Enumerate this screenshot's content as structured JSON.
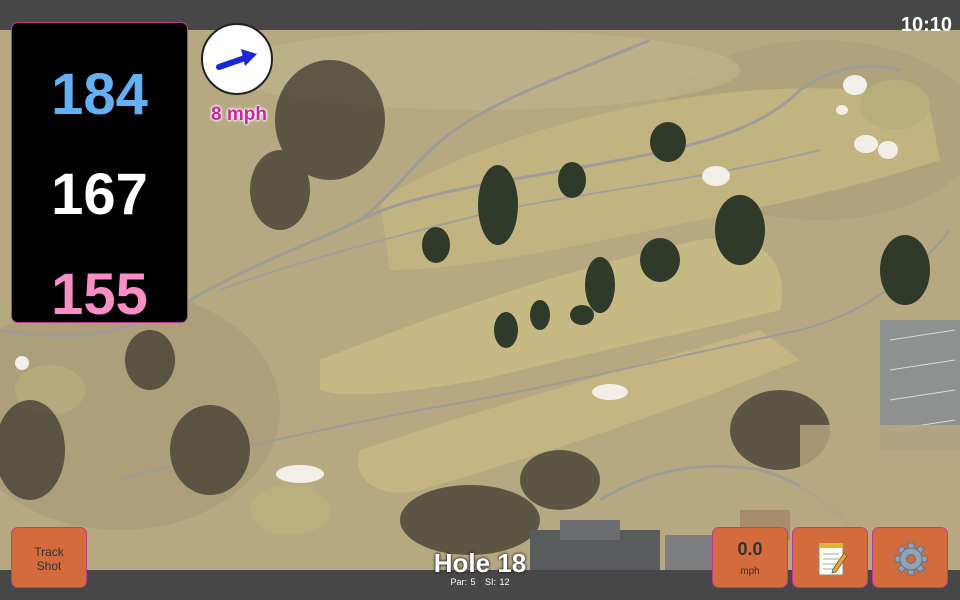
{
  "status": {
    "time": "10:10"
  },
  "distances": {
    "back": "184",
    "middle": "167",
    "front": "155"
  },
  "wind": {
    "speed": "8 mph",
    "direction_icon": "arrow-up-right-icon"
  },
  "buttons": {
    "track_shot_line1": "Track",
    "track_shot_line2": "Shot",
    "speed_value": "0.0",
    "speed_unit": "mph",
    "notes_icon": "notepad-icon",
    "settings_icon": "gear-icon"
  },
  "hole": {
    "title": "Hole 18",
    "par": "Par: 5",
    "si": "SI: 12"
  },
  "colors": {
    "back": "#64b0f4",
    "middle": "#ffffff",
    "front": "#f88dc7",
    "wind_text": "#c928a2",
    "button": "#d36b3d",
    "accent_border": "#c03a94"
  }
}
